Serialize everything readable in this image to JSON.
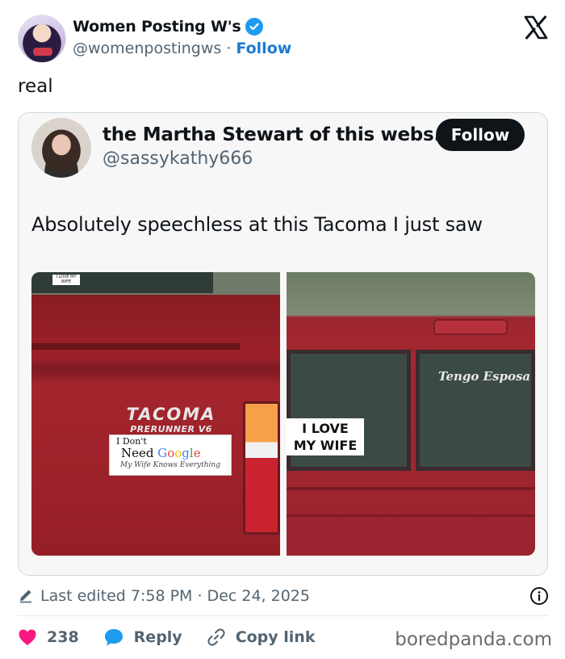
{
  "author": {
    "name": "Women Posting W's",
    "handle": "@womenpostingws",
    "separator": "·",
    "follow_label": "Follow"
  },
  "post": {
    "text": "real"
  },
  "quoted": {
    "name": "the Martha Stewart of this webs...",
    "handle": "@sassykathy666",
    "follow_label": "Follow",
    "text": "Absolutely speechless at this Tacoma I just saw",
    "photo_left": {
      "window_sticker": "I LOVE MY WIFE",
      "badge_main": "TACOMA",
      "badge_sub": "PRERUNNER V6",
      "sticker_line1": "I Don't",
      "sticker_line2_a": "Need ",
      "sticker_google": [
        "G",
        "o",
        "o",
        "g",
        "l",
        "e"
      ],
      "sticker_line3": "My Wife Knows Everything"
    },
    "photo_right": {
      "decal": "Tengo Esposa",
      "sticker_line1": "I LOVE",
      "sticker_line2": "MY WIFE"
    }
  },
  "meta": {
    "edited": "Last edited 7:58 PM · Dec 24, 2025"
  },
  "actions": {
    "likes": "238",
    "reply": "Reply",
    "copy_link": "Copy link"
  },
  "watermark": "boredpanda.com",
  "colors": {
    "verified": "#1d9bf0",
    "follow_link": "#1d7bd0",
    "heart": "#f91880",
    "reply_bubble": "#1d9bf0"
  }
}
